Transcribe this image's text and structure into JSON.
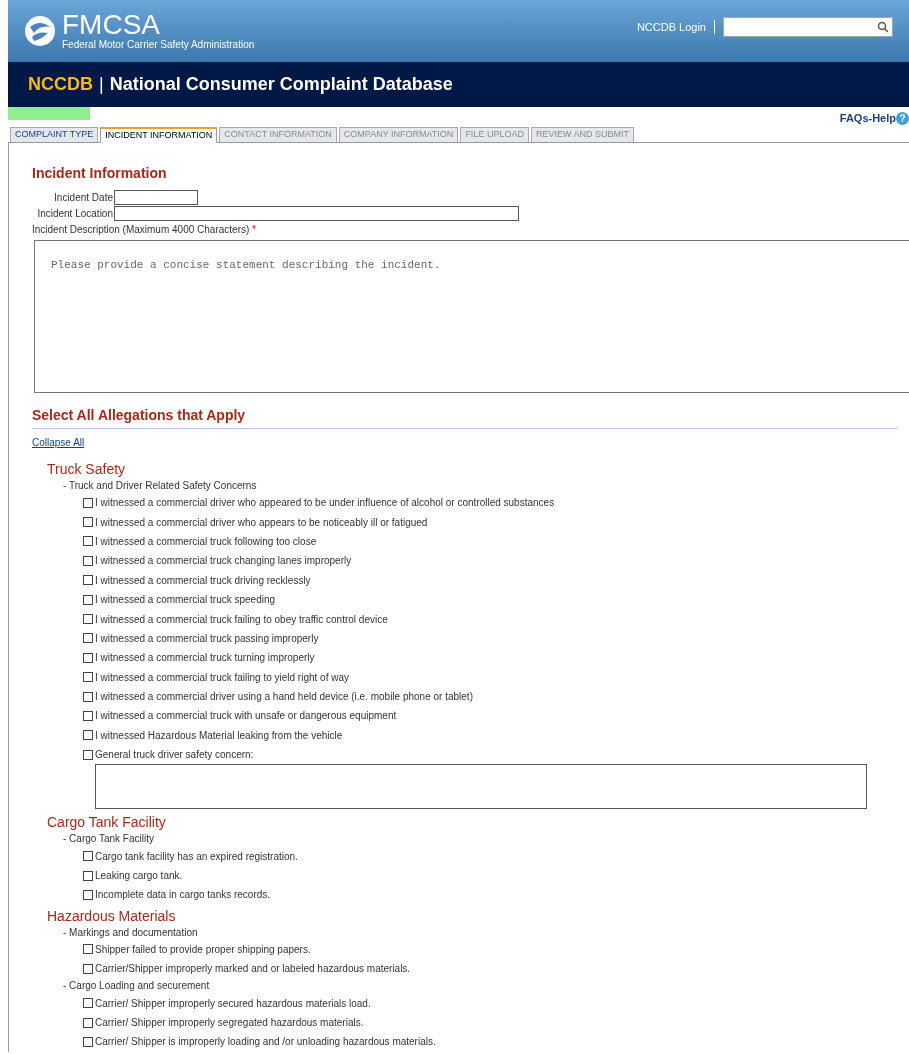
{
  "header": {
    "logo_text": "FMCSA",
    "logo_subtitle": "Federal Motor Carrier Safety Administration",
    "login_link": "NCCDB Login"
  },
  "banner": {
    "acronym": "NCCDB",
    "separator": "|",
    "title": "National Consumer Complaint Database"
  },
  "progress": {
    "level": 0.1
  },
  "help_link": "FAQs-Help",
  "help_icon": "?",
  "tabs": [
    {
      "label": "COMPLAINT TYPE",
      "selected": false,
      "completed": true
    },
    {
      "label": "INCIDENT INFORMATION",
      "selected": true,
      "completed": false
    },
    {
      "label": "CONTACT INFORMATION",
      "selected": false,
      "completed": false
    },
    {
      "label": "COMPANY INFORMATION",
      "selected": false,
      "completed": false
    },
    {
      "label": "FILE UPLOAD",
      "selected": false,
      "completed": false
    },
    {
      "label": "REVIEW AND SUBMIT",
      "selected": false,
      "completed": false
    }
  ],
  "incident": {
    "title": "Incident Information",
    "fields": [
      {
        "label": "Incident Date",
        "kind": "short"
      },
      {
        "label": "Incident Location",
        "kind": "long"
      }
    ],
    "description": {
      "label": "Incident Description (Maximum 4000 Characters)",
      "required_mark": "*",
      "placeholder": "Please provide a concise statement describing the incident."
    }
  },
  "allegations": {
    "title": "Select All Allegations that Apply",
    "collapse_link": "Collapse All",
    "sections": [
      {
        "title": "Truck Safety",
        "groups": [
          {
            "title": "- Truck and Driver Related Safety Concerns",
            "items": [
              {
                "label": "I witnessed a commercial driver who appeared to be under influence of alcohol or controlled substances",
                "kind": "checkbox",
                "checked": false
              },
              {
                "label": "I witnessed a commercial driver who appears to be noticeably ill or fatigued",
                "kind": "checkbox",
                "checked": false
              },
              {
                "label": "I witnessed a commercial truck following too close",
                "kind": "checkbox",
                "checked": false
              },
              {
                "label": "I witnessed a commercial truck changing lanes improperly",
                "kind": "checkbox",
                "checked": false
              },
              {
                "label": "I witnessed a commercial truck driving recklessly",
                "kind": "checkbox",
                "checked": false
              },
              {
                "label": "I witnessed a commercial truck speeding",
                "kind": "checkbox",
                "checked": false
              },
              {
                "label": "I witnessed a commercial truck failing to obey traffic control device",
                "kind": "checkbox",
                "checked": false
              },
              {
                "label": "I witnessed a commercial truck passing improperly",
                "kind": "checkbox",
                "checked": false
              },
              {
                "label": "I witnessed a commercial truck turning improperly",
                "kind": "checkbox",
                "checked": false
              },
              {
                "label": "I witnessed a commercial truck failing to yield right of way",
                "kind": "checkbox",
                "checked": false
              },
              {
                "label": "I witnessed a commercial driver using a hand held device (i.e. mobile phone or tablet)",
                "kind": "checkbox",
                "checked": false
              },
              {
                "label": "I witnessed a commercial truck with unsafe or dangerous equipment",
                "kind": "checkbox",
                "checked": false
              },
              {
                "label": "I witnessed Hazardous Material leaking from the vehicle",
                "kind": "checkbox",
                "checked": false
              },
              {
                "label": "General truck driver safety concern:",
                "kind": "checkbox_with_text",
                "checked": false
              }
            ]
          }
        ]
      },
      {
        "title": "Cargo Tank Facility",
        "groups": [
          {
            "title": "- Cargo Tank Facility",
            "items": [
              {
                "label": "Cargo tank facility has an expired registration.",
                "kind": "checkbox",
                "checked": false
              },
              {
                "label": "Leaking cargo tank.",
                "kind": "checkbox",
                "checked": false
              },
              {
                "label": "Incomplete data in cargo tanks records.",
                "kind": "checkbox",
                "checked": false
              }
            ]
          }
        ]
      },
      {
        "title": "Hazardous Materials",
        "groups": [
          {
            "title": "- Markings and documentation",
            "items": [
              {
                "label": "Shipper failed to provide proper shipping papers.",
                "kind": "checkbox",
                "checked": false
              },
              {
                "label": "Carrier/Shipper improperly marked and or labeled hazardous materials.",
                "kind": "checkbox",
                "checked": false
              }
            ]
          },
          {
            "title": "- Cargo Loading and securement",
            "items": [
              {
                "label": "Carrier/ Shipper improperly secured hazardous materials load.",
                "kind": "checkbox",
                "checked": false
              },
              {
                "label": "Carrier/ Shipper improperly segregated hazardous materials.",
                "kind": "checkbox",
                "checked": false
              },
              {
                "label": "Carrier/ Shipper is improperly loading and /or unloading hazardous materials.",
                "kind": "checkbox",
                "checked": false
              }
            ]
          }
        ]
      }
    ]
  }
}
